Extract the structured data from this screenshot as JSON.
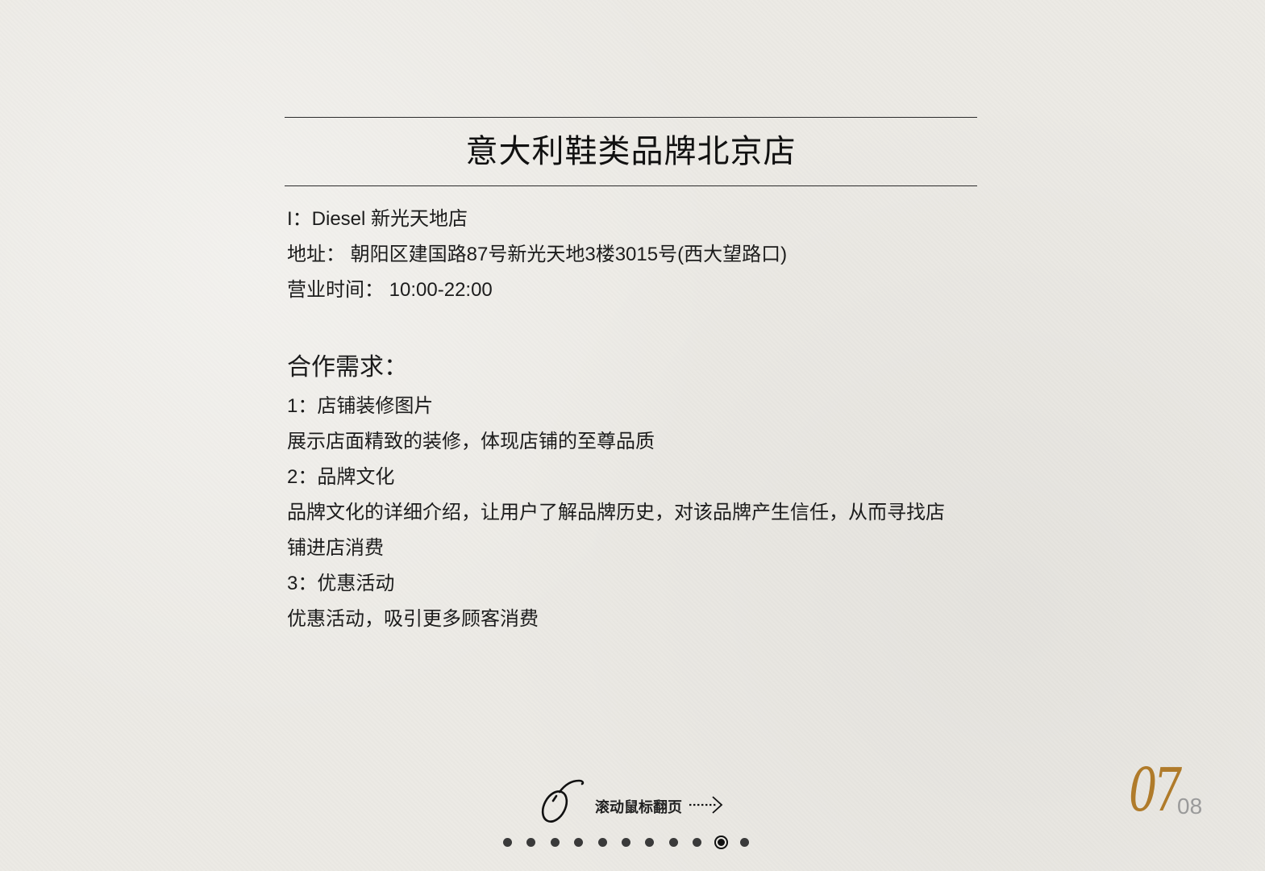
{
  "title": "意大利鞋类品牌北京店",
  "store": {
    "name": "I：Diesel 新光天地店",
    "address": "地址： 朝阳区建国路87号新光天地3楼3015号(西大望路口)",
    "hours": "营业时间： 10:00-22:00"
  },
  "requirements": {
    "heading": "合作需求：",
    "lines": [
      "1：店铺装修图片",
      "展示店面精致的装修，体现店铺的至尊品质",
      "2：品牌文化",
      "品牌文化的详细介绍，让用户了解品牌历史，对该品牌产生信任，从而寻找店",
      "铺进店消费",
      "3：优惠活动",
      "优惠活动，吸引更多顾客消费"
    ]
  },
  "navigation": {
    "scroll_hint": "滚动鼠标翻页",
    "dot_count": 11,
    "active_dot": 10,
    "current_page": "07",
    "total_pages": "08"
  },
  "colors": {
    "background": "#eceae5",
    "text": "#1a1a1a",
    "accent_page_number": "#b07b2a",
    "total_page_number": "#9a9a9a"
  },
  "icons": [
    "mouse-icon",
    "dotted-arrow-icon"
  ]
}
